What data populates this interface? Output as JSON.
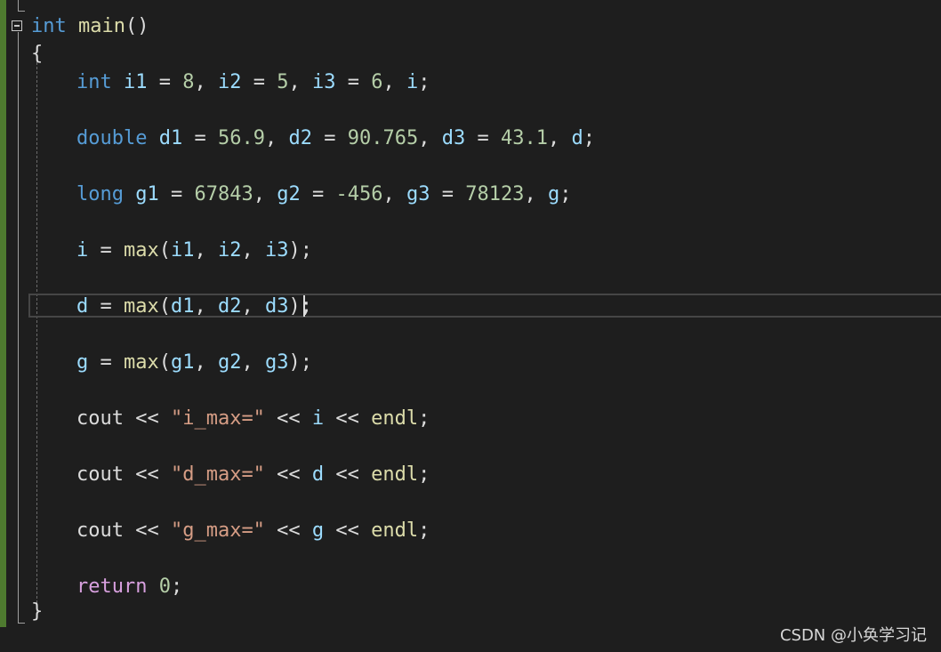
{
  "code": {
    "lines": [
      [
        {
          "t": "int",
          "c": "kw"
        },
        {
          "t": " ",
          "c": "pl"
        },
        {
          "t": "main",
          "c": "fn"
        },
        {
          "t": "()",
          "c": "pl"
        }
      ],
      [
        {
          "t": "{",
          "c": "pl"
        }
      ],
      [
        {
          "t": "int",
          "c": "kw"
        },
        {
          "t": " ",
          "c": "pl"
        },
        {
          "t": "i1",
          "c": "var"
        },
        {
          "t": " = ",
          "c": "pl"
        },
        {
          "t": "8",
          "c": "num"
        },
        {
          "t": ", ",
          "c": "pl"
        },
        {
          "t": "i2",
          "c": "var"
        },
        {
          "t": " = ",
          "c": "pl"
        },
        {
          "t": "5",
          "c": "num"
        },
        {
          "t": ", ",
          "c": "pl"
        },
        {
          "t": "i3",
          "c": "var"
        },
        {
          "t": " = ",
          "c": "pl"
        },
        {
          "t": "6",
          "c": "num"
        },
        {
          "t": ", ",
          "c": "pl"
        },
        {
          "t": "i",
          "c": "var"
        },
        {
          "t": ";",
          "c": "pl"
        }
      ],
      [
        {
          "t": "double",
          "c": "kw"
        },
        {
          "t": " ",
          "c": "pl"
        },
        {
          "t": "d1",
          "c": "var"
        },
        {
          "t": " = ",
          "c": "pl"
        },
        {
          "t": "56.9",
          "c": "num"
        },
        {
          "t": ", ",
          "c": "pl"
        },
        {
          "t": "d2",
          "c": "var"
        },
        {
          "t": " = ",
          "c": "pl"
        },
        {
          "t": "90.765",
          "c": "num"
        },
        {
          "t": ", ",
          "c": "pl"
        },
        {
          "t": "d3",
          "c": "var"
        },
        {
          "t": " = ",
          "c": "pl"
        },
        {
          "t": "43.1",
          "c": "num"
        },
        {
          "t": ", ",
          "c": "pl"
        },
        {
          "t": "d",
          "c": "var"
        },
        {
          "t": ";",
          "c": "pl"
        }
      ],
      [
        {
          "t": "long",
          "c": "kw"
        },
        {
          "t": " ",
          "c": "pl"
        },
        {
          "t": "g1",
          "c": "var"
        },
        {
          "t": " = ",
          "c": "pl"
        },
        {
          "t": "67843",
          "c": "num"
        },
        {
          "t": ", ",
          "c": "pl"
        },
        {
          "t": "g2",
          "c": "var"
        },
        {
          "t": " = ",
          "c": "pl"
        },
        {
          "t": "-456",
          "c": "num"
        },
        {
          "t": ", ",
          "c": "pl"
        },
        {
          "t": "g3",
          "c": "var"
        },
        {
          "t": " = ",
          "c": "pl"
        },
        {
          "t": "78123",
          "c": "num"
        },
        {
          "t": ", ",
          "c": "pl"
        },
        {
          "t": "g",
          "c": "var"
        },
        {
          "t": ";",
          "c": "pl"
        }
      ],
      [
        {
          "t": "i",
          "c": "var"
        },
        {
          "t": " = ",
          "c": "pl"
        },
        {
          "t": "max",
          "c": "fn"
        },
        {
          "t": "(",
          "c": "pl"
        },
        {
          "t": "i1",
          "c": "var"
        },
        {
          "t": ", ",
          "c": "pl"
        },
        {
          "t": "i2",
          "c": "var"
        },
        {
          "t": ", ",
          "c": "pl"
        },
        {
          "t": "i3",
          "c": "var"
        },
        {
          "t": ");",
          "c": "pl"
        }
      ],
      [
        {
          "t": "d",
          "c": "var"
        },
        {
          "t": " = ",
          "c": "pl"
        },
        {
          "t": "max",
          "c": "fn"
        },
        {
          "t": "(",
          "c": "pl"
        },
        {
          "t": "d1",
          "c": "var"
        },
        {
          "t": ", ",
          "c": "pl"
        },
        {
          "t": "d2",
          "c": "var"
        },
        {
          "t": ", ",
          "c": "pl"
        },
        {
          "t": "d3",
          "c": "var"
        },
        {
          "t": ");",
          "c": "pl"
        }
      ],
      [
        {
          "t": "g",
          "c": "var"
        },
        {
          "t": " = ",
          "c": "pl"
        },
        {
          "t": "max",
          "c": "fn"
        },
        {
          "t": "(",
          "c": "pl"
        },
        {
          "t": "g1",
          "c": "var"
        },
        {
          "t": ", ",
          "c": "pl"
        },
        {
          "t": "g2",
          "c": "var"
        },
        {
          "t": ", ",
          "c": "pl"
        },
        {
          "t": "g3",
          "c": "var"
        },
        {
          "t": ");",
          "c": "pl"
        }
      ],
      [
        {
          "t": "cout",
          "c": "pl"
        },
        {
          "t": " << ",
          "c": "pl"
        },
        {
          "t": "\"i_max=\"",
          "c": "str"
        },
        {
          "t": " << ",
          "c": "pl"
        },
        {
          "t": "i",
          "c": "var"
        },
        {
          "t": " << ",
          "c": "pl"
        },
        {
          "t": "endl",
          "c": "fn"
        },
        {
          "t": ";",
          "c": "pl"
        }
      ],
      [
        {
          "t": "cout",
          "c": "pl"
        },
        {
          "t": " << ",
          "c": "pl"
        },
        {
          "t": "\"d_max=\"",
          "c": "str"
        },
        {
          "t": " << ",
          "c": "pl"
        },
        {
          "t": "d",
          "c": "var"
        },
        {
          "t": " << ",
          "c": "pl"
        },
        {
          "t": "endl",
          "c": "fn"
        },
        {
          "t": ";",
          "c": "pl"
        }
      ],
      [
        {
          "t": "cout",
          "c": "pl"
        },
        {
          "t": " << ",
          "c": "pl"
        },
        {
          "t": "\"g_max=\"",
          "c": "str"
        },
        {
          "t": " << ",
          "c": "pl"
        },
        {
          "t": "g",
          "c": "var"
        },
        {
          "t": " << ",
          "c": "pl"
        },
        {
          "t": "endl",
          "c": "fn"
        },
        {
          "t": ";",
          "c": "pl"
        }
      ],
      [
        {
          "t": "return",
          "c": "kw2"
        },
        {
          "t": " ",
          "c": "pl"
        },
        {
          "t": "0",
          "c": "num"
        },
        {
          "t": ";",
          "c": "pl"
        }
      ],
      [
        {
          "t": "}",
          "c": "pl"
        }
      ]
    ]
  },
  "watermark": "CSDN @小奂学习记",
  "colors": {
    "background": "#1e1e1e",
    "keyword": "#569cd6",
    "control_keyword": "#d8a0df",
    "function": "#dcdcaa",
    "variable": "#9cdcfe",
    "number": "#b5cea8",
    "string": "#d69d85",
    "plain": "#dcdcdc",
    "change_margin": "#4e7a2f"
  },
  "icons": {
    "fold": "collapse-minus-icon"
  }
}
